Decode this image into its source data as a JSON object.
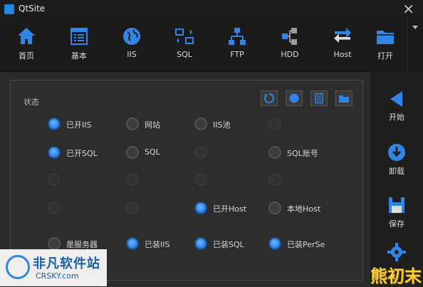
{
  "app": {
    "title": "QtSite"
  },
  "toolbar": {
    "items": [
      {
        "label": "首页",
        "icon": "home-icon"
      },
      {
        "label": "基本",
        "icon": "list-window-icon"
      },
      {
        "label": "IIS",
        "icon": "globe-icon"
      },
      {
        "label": "SQL",
        "icon": "swap-arrows-icon"
      },
      {
        "label": "FTP",
        "icon": "network-icon"
      },
      {
        "label": "HDD",
        "icon": "drive-blocks-icon"
      },
      {
        "label": "Host",
        "icon": "exchange-icon"
      },
      {
        "label": "打开",
        "icon": "folder-icon"
      }
    ]
  },
  "panel": {
    "status_label": "状态",
    "options": [
      {
        "label": "已开IIS",
        "state": "on"
      },
      {
        "label": "网站",
        "state": "off"
      },
      {
        "label": "IIS池",
        "state": "off"
      },
      {
        "label": "已开SQL",
        "state": "on"
      },
      {
        "label": "SQL",
        "state": "off"
      },
      {
        "label": "SQL账号",
        "state": "off"
      },
      {
        "label": "已开Host",
        "state": "on"
      },
      {
        "label": "本地Host",
        "state": "off"
      },
      {
        "label": "是服务器",
        "state": "off"
      },
      {
        "label": "已装IIS",
        "state": "on"
      },
      {
        "label": "已装SQL",
        "state": "on"
      },
      {
        "label": "已装PerSe",
        "state": "on"
      }
    ]
  },
  "sidebar": {
    "start": "开始",
    "uninstall": "卸载",
    "save": "保存"
  },
  "watermark": {
    "cn": "非凡软件站",
    "en": "CRSKY.com",
    "corner": "熊初末"
  },
  "colors": {
    "accent": "#2f86e8",
    "toolbar_bg": "#1a1a1a",
    "panel_bg": "#2d2d2d"
  }
}
